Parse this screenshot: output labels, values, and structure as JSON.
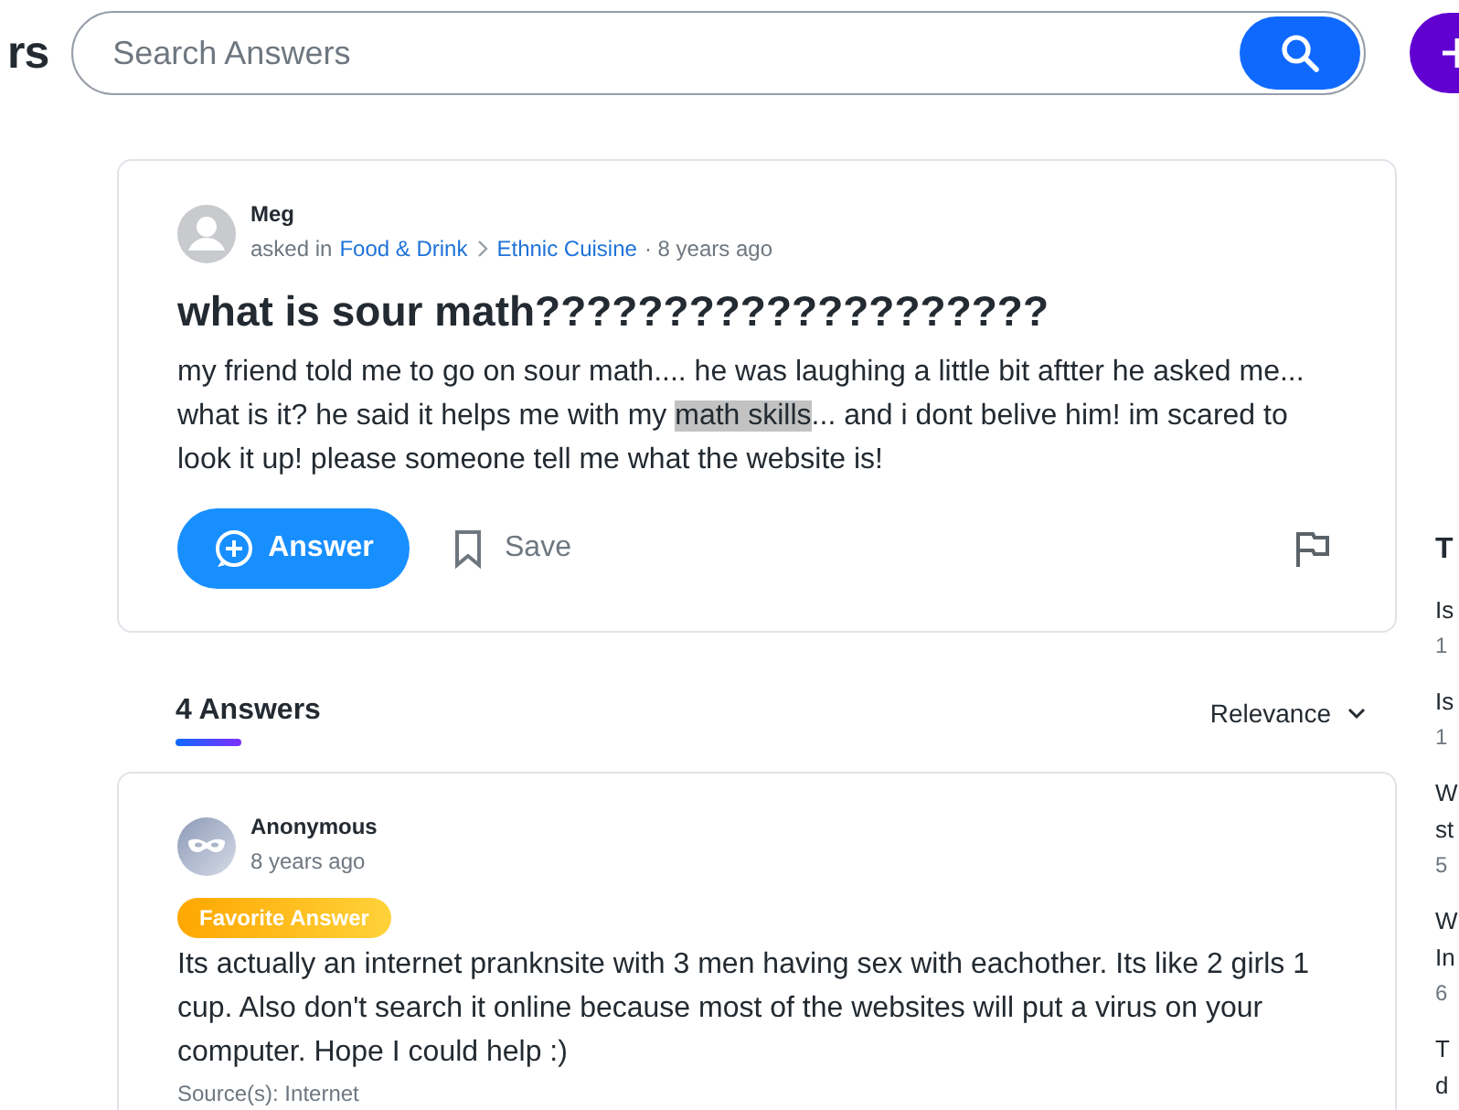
{
  "header": {
    "logo_fragment": "rs",
    "search": {
      "placeholder": "Search Answers"
    }
  },
  "question": {
    "author": "Meg",
    "asked_in": "asked in",
    "category": "Food & Drink",
    "subcategory": "Ethnic Cuisine",
    "time": "· 8 years ago",
    "title": "what is sour math????????????????????",
    "body_parts": [
      {
        "text": "my friend told me to go on sour math.... he was laughing a little bit aftter he asked me... what is it? he said it helps me with my ",
        "highlighted": false
      },
      {
        "text": "math skills",
        "highlighted": true
      },
      {
        "text": "... and i dont belive him! im scared to look it up! please someone tell me what the website is!",
        "highlighted": false
      }
    ],
    "answer_button": "Answer",
    "save_button": "Save"
  },
  "answers_header": {
    "count": "4 Answers",
    "sort": "Relevance"
  },
  "answers": [
    {
      "author": "Anonymous",
      "time": "8 years ago",
      "badge": "Favorite Answer",
      "text": "Its actually an internet pranknsite with 3 men having sex with eachother. Its like 2 girls 1 cup. Also don't search it online because most of the websites will put a virus on your computer. Hope I could help :)",
      "source": "Source(s): Internet"
    }
  ],
  "sidebar": {
    "heading": "T",
    "items": [
      {
        "lines": [
          "Is"
        ],
        "meta": "1"
      },
      {
        "lines": [
          "Is"
        ],
        "meta": "1"
      },
      {
        "lines": [
          "W",
          "st"
        ],
        "meta": "5"
      },
      {
        "lines": [
          "W",
          "In"
        ],
        "meta": "6"
      },
      {
        "lines": [
          "T",
          "d"
        ]
      }
    ]
  }
}
